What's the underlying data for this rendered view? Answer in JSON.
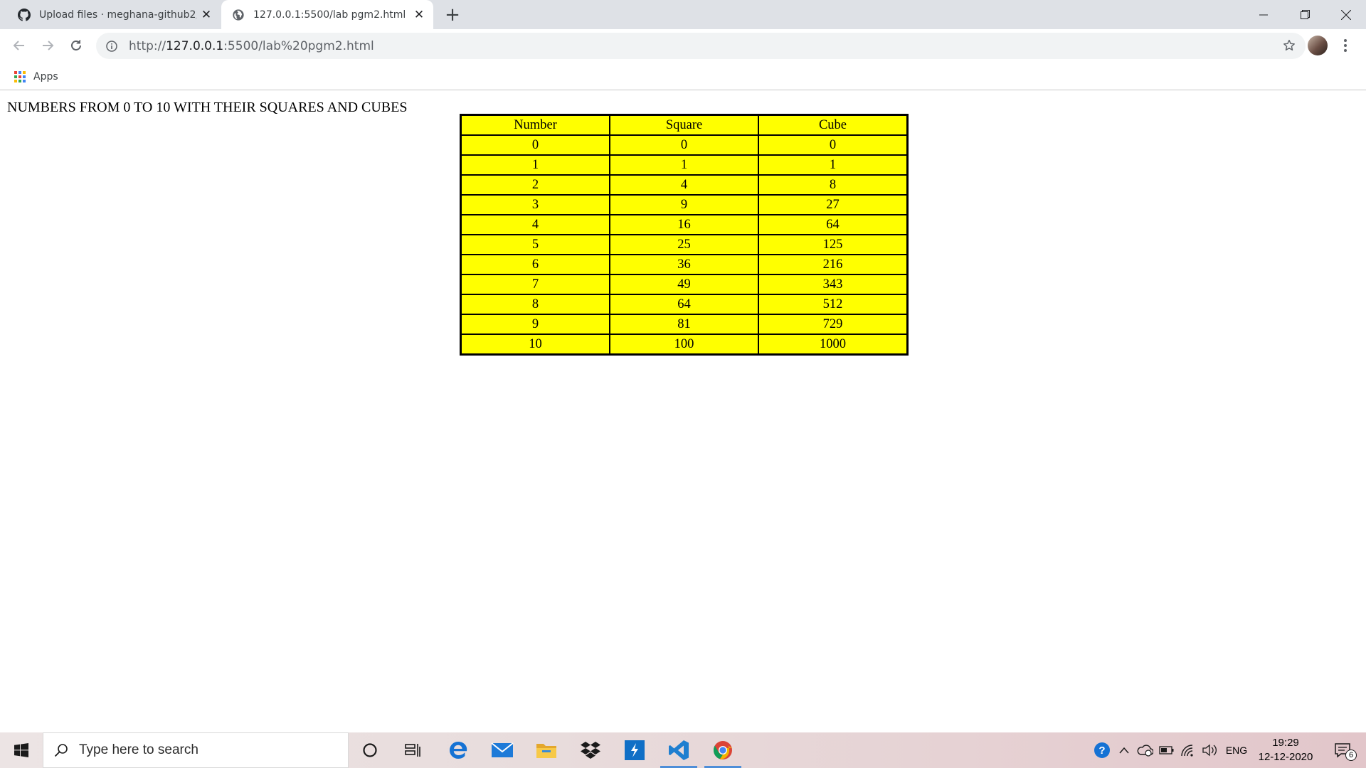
{
  "browser": {
    "tabs": [
      {
        "title": "Upload files · meghana-github2/",
        "favicon": "github-icon",
        "active": false
      },
      {
        "title": "127.0.0.1:5500/lab pgm2.html",
        "favicon": "globe-icon",
        "active": true
      }
    ],
    "address_bar": {
      "prefix": "http://",
      "host": "127.0.0.1",
      "rest": ":5500/lab%20pgm2.html"
    },
    "bookmarks": [
      {
        "label": "Apps",
        "icon": "apps-grid-icon"
      }
    ]
  },
  "page": {
    "heading": "NUMBERS FROM 0 TO 10 WITH THEIR SQUARES AND CUBES",
    "table": {
      "headers": [
        "Number",
        "Square",
        "Cube"
      ],
      "rows": [
        [
          "0",
          "0",
          "0"
        ],
        [
          "1",
          "1",
          "1"
        ],
        [
          "2",
          "4",
          "8"
        ],
        [
          "3",
          "9",
          "27"
        ],
        [
          "4",
          "16",
          "64"
        ],
        [
          "5",
          "25",
          "125"
        ],
        [
          "6",
          "36",
          "216"
        ],
        [
          "7",
          "49",
          "343"
        ],
        [
          "8",
          "64",
          "512"
        ],
        [
          "9",
          "81",
          "729"
        ],
        [
          "10",
          "100",
          "1000"
        ]
      ],
      "background": "#ffff00",
      "border_color": "#000000"
    }
  },
  "taskbar": {
    "search_placeholder": "Type here to search",
    "apps": [
      "cortana-icon",
      "task-view-icon",
      "edge-icon",
      "mail-icon",
      "file-explorer-icon",
      "dropbox-icon",
      "power-automate-icon",
      "vscode-icon",
      "chrome-icon"
    ],
    "language": "ENG",
    "time": "19:29",
    "date": "12-12-2020",
    "notification_count": "6"
  }
}
